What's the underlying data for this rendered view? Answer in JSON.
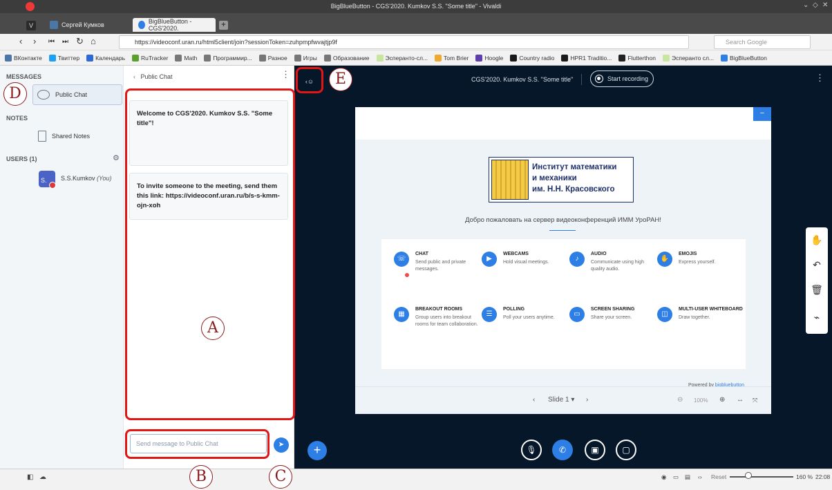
{
  "window": {
    "title": "BigBlueButton - CGS'2020. Kumkov S.S. \"Some title\" - Vivaldi",
    "controls": [
      "⌄",
      "◇",
      "✕"
    ]
  },
  "tabs": [
    {
      "label": "Сергей Кумков",
      "favicon_color": "#4a76a8",
      "active": false
    },
    {
      "label": "BigBlueButton - CGS'2020.",
      "favicon_color": "#2d7ee5",
      "active": true
    }
  ],
  "address_bar": {
    "url": "https://videoconf.uran.ru/html5client/join?sessionToken=zuhpmpfwvajtjp9f",
    "search_placeholder": "Search Google"
  },
  "bookmarks": [
    {
      "label": "ВКонтакте",
      "color": "#4a76a8"
    },
    {
      "label": "Твиттер",
      "color": "#1da1f2"
    },
    {
      "label": "Календарь",
      "color": "#2d6ad9"
    },
    {
      "label": "RuTracker",
      "color": "#5aa02c"
    },
    {
      "label": "Math",
      "color": "#777777"
    },
    {
      "label": "Программир...",
      "color": "#777777"
    },
    {
      "label": "Разное",
      "color": "#777777"
    },
    {
      "label": "Игры",
      "color": "#777777"
    },
    {
      "label": "Образование",
      "color": "#777777"
    },
    {
      "label": "Эсперанто-сл...",
      "color": "#c8e6a0"
    },
    {
      "label": "Tom Brier",
      "color": "#f0a830"
    },
    {
      "label": "Hoogle",
      "color": "#5e3ea8"
    },
    {
      "label": "Country radio",
      "color": "#1a1a1a"
    },
    {
      "label": "HPR1 Traditio...",
      "color": "#1a1a1a"
    },
    {
      "label": "Flutterthon",
      "color": "#222222"
    },
    {
      "label": "Эсперанто сл...",
      "color": "#c8e6a0"
    },
    {
      "label": "BigBlueButton",
      "color": "#2d7ee5"
    }
  ],
  "sidebar": {
    "messages_heading": "MESSAGES",
    "public_chat": "Public Chat",
    "notes_heading": "NOTES",
    "shared_notes": "Shared Notes",
    "users_heading": "USERS (1)",
    "user_initials": "S.",
    "user_name": "S.S.Kumkov",
    "user_you": "(You)"
  },
  "chat": {
    "header": "Public Chat",
    "welcome_prefix": "Welcome to ",
    "welcome_session": "CGS'2020. Kumkov S.S. \"Some title\"",
    "welcome_suffix": "!",
    "invite_message": "To invite someone to the meeting, send them this link: https://videoconf.uran.ru/b/s-s-kmm-ojn-xoh",
    "input_placeholder": "Send message to Public Chat"
  },
  "main": {
    "meeting_title": "CGS'2020. Kumkov S.S. \"Some title\"",
    "record_label": "Start recording"
  },
  "slide": {
    "institute_lines": [
      "Институт математики",
      "и механики",
      "им. Н.Н. Красовского"
    ],
    "welcome_text": "Добро пожаловать на сервер видеоконференций ИММ УроРАН!",
    "features": [
      {
        "title": "CHAT",
        "desc": "Send public and private messages.",
        "icon": "chat-icon"
      },
      {
        "title": "WEBCAMS",
        "desc": "Hold visual meetings.",
        "icon": "webcam-icon"
      },
      {
        "title": "AUDIO",
        "desc": "Communicate using high quality audio.",
        "icon": "audio-icon"
      },
      {
        "title": "EMOJIS",
        "desc": "Express yourself.",
        "icon": "hand-icon"
      },
      {
        "title": "BREAKOUT ROOMS",
        "desc": "Group users into breakout rooms for team collaboration.",
        "icon": "breakout-icon"
      },
      {
        "title": "POLLING",
        "desc": "Poll your users anytime.",
        "icon": "poll-icon"
      },
      {
        "title": "SCREEN SHARING",
        "desc": "Share your screen.",
        "icon": "screen-icon"
      },
      {
        "title": "MULTI-USER WHITEBOARD",
        "desc": "Draw together.",
        "icon": "whiteboard-icon"
      }
    ],
    "powered_prefix": "Powered by ",
    "powered_link": "bigbluebutton",
    "current_slide": "Slide 1",
    "zoom": "100%"
  },
  "statusbar": {
    "reset_label": "Reset",
    "zoom_level": "160 %",
    "time": "22:08"
  },
  "annotations": [
    "A",
    "B",
    "C",
    "D",
    "E"
  ],
  "colors": {
    "accent": "#2d7ee5",
    "annotation": "#e41515",
    "main_bg": "#06172a"
  }
}
